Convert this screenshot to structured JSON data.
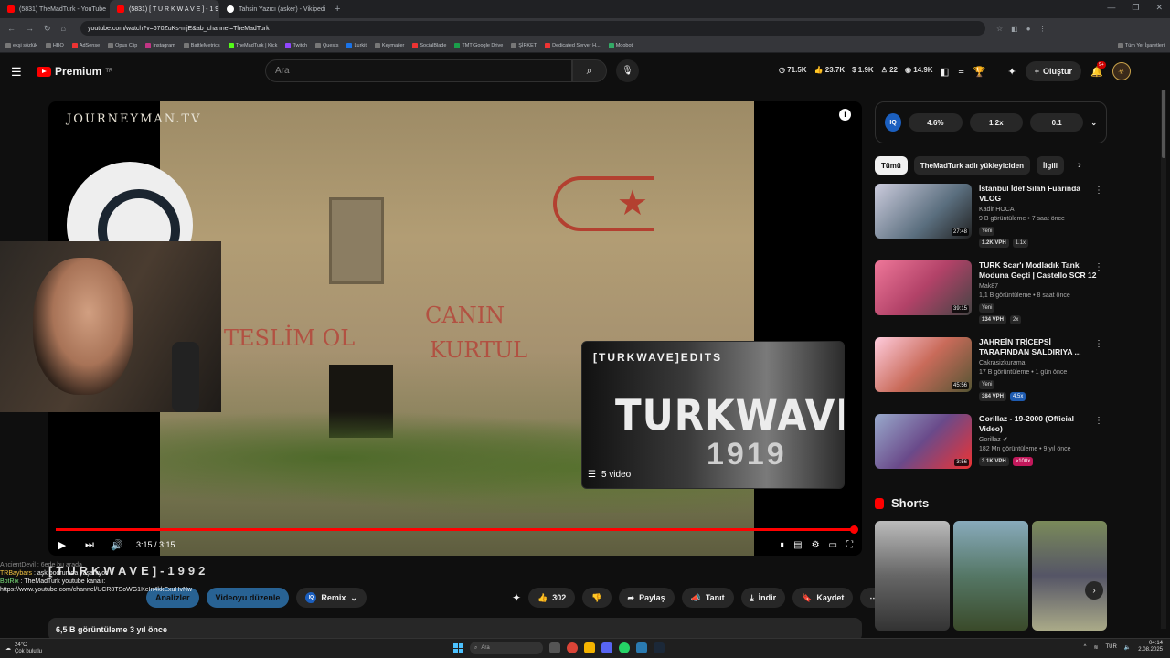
{
  "browser": {
    "tabs": [
      {
        "label": "(5831) TheMadTurk - YouTube"
      },
      {
        "label": "(5831) [ T U R K W A V E ] - 1 9"
      },
      {
        "label": "Tahsin Yazıcı (asker) - Vikipedi"
      }
    ],
    "url": "youtube.com/watch?v=670ZuKs-mjE&ab_channel=TheMadTurk"
  },
  "bookmarks": [
    "ekşi sözlük",
    "HBO",
    "AdSense",
    "Opus Clip",
    "Instagram",
    "BattleMetrics",
    "TheMadTurk | Kick",
    "Twitch",
    "Quests",
    "Lurkit",
    "Keymailer",
    "SocialBlade",
    "TMT Google Drive",
    "ŞİRKET",
    "Dedicated Server H...",
    "Moobot"
  ],
  "bookmarks_all": "Tüm Yer İşaretleri",
  "header": {
    "logo": "Premium",
    "logo_sup": "TR",
    "search_placeholder": "Ara",
    "stats": [
      "71.5K",
      "23.7K",
      "1.9K",
      "22",
      "14.9K"
    ],
    "create_label": "Oluştur",
    "notif_badge": "9+"
  },
  "player": {
    "overlay_logo": "JOURNEYMAN.TV",
    "graffiti1": "TESLİM OL",
    "graffiti2": "CANIN",
    "graffiti3": "KURTUL",
    "time": "3:15 / 3:15",
    "progress": 1.0,
    "endcard": {
      "channel": "[TURKWAVE]EDITS",
      "big": "TURKWAVE",
      "year": "1919",
      "count": "5 video"
    }
  },
  "chat": [
    {
      "name": "AncientDevil",
      "text": "6ede bu arada"
    },
    {
      "name": "TRBaybars",
      "text": "aşk bodrumda yaşanıyor"
    },
    {
      "name": "BotRix",
      "text": "TheMadTurk youtube kanalı:"
    },
    {
      "name": "",
      "text": "https://www.youtube.com/channel/UCR8TSoWG1KeIn4kkExuHvNw"
    }
  ],
  "video": {
    "title": "[TURKWAVE]-1992",
    "analytics": "Analizler",
    "edit": "Videoyu düzenle",
    "remix": "Remix",
    "likes": "302",
    "share": "Paylaş",
    "promote": "Tanıt",
    "download": "İndir",
    "save": "Kaydet",
    "desc": "6,5 B görüntüleme  3 yıl önce"
  },
  "sidebar": {
    "ext": {
      "a": "4.6%",
      "b": "1.2x",
      "c": "0.1"
    },
    "chips": [
      "Tümü",
      "TheMadTurk adlı yükleyiciden",
      "İlgili"
    ],
    "recs": [
      {
        "title": "İstanbul İdef Silah  Fuarında VLOG",
        "channel": "Kadir HOCA",
        "meta": "9 B görüntüleme • 7 saat önce",
        "new": "Yeni",
        "vph": "1.2K VPH",
        "x": "1.1x",
        "dur": "27:48",
        "color": "#5a6e7e"
      },
      {
        "title": "TURK Scar'ı Modladık Tank Moduna Geçti | Castello SCR 12",
        "channel": "Mak87",
        "meta": "1,1 B görüntüleme • 8 saat önce",
        "new": "Yeni",
        "vph": "134 VPH",
        "x": "2x",
        "dur": "39:15",
        "color": "#b24268"
      },
      {
        "title": "JAHREİN TRİCEPSİ TARAFINDAN SALDIRIYA ...",
        "channel": "Cakrasizkurama",
        "meta": "17 B görüntüleme • 1 gün önce",
        "new": "Yeni",
        "vph": "384 VPH",
        "x": "4.5x",
        "dur": "45:56",
        "color": "#c96b5a"
      },
      {
        "title": "Gorillaz - 19-2000 (Official Video)",
        "channel": "Gorillaz",
        "meta": "182 Mn görüntüleme • 9 yıl önce",
        "new": "",
        "vph": "3.1K VPH",
        "x": ">100x",
        "dur": "3:56",
        "color": "#6a4a8a"
      }
    ],
    "shorts_title": "Shorts"
  },
  "taskbar": {
    "weather": "24°C",
    "weather_sub": "Çok bulutlu",
    "search": "Ara",
    "lang": "TUR",
    "time": "04:14",
    "date": "2.08.2025"
  }
}
